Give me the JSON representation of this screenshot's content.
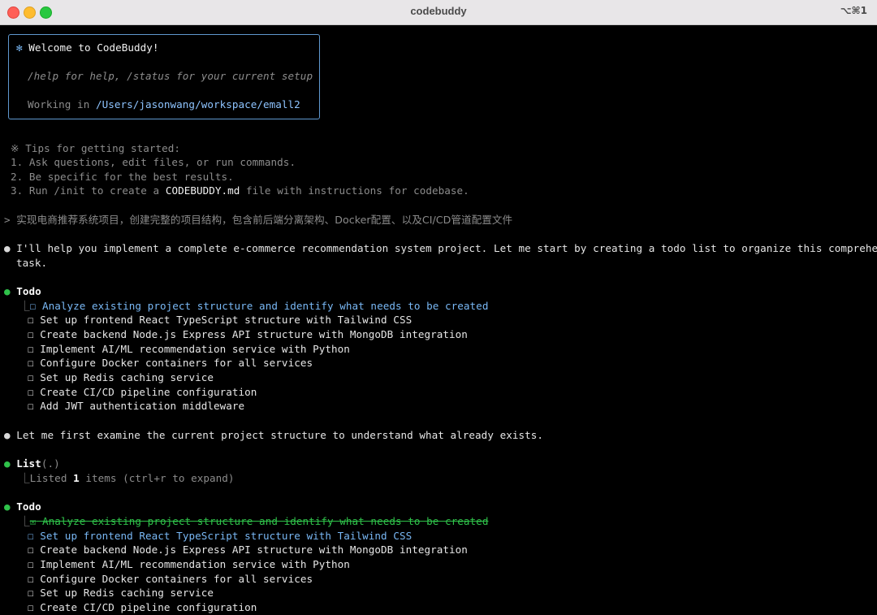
{
  "window": {
    "title": "codebuddy",
    "shortcut": "⌥⌘1"
  },
  "welcome": {
    "star": "✻",
    "title": "Welcome to CodeBuddy!",
    "help": "/help for help, /status for your current setup",
    "working_label": "Working in ",
    "working_path": "/Users/jasonwang/workspace/emall2"
  },
  "tips": {
    "heading": "※ Tips for getting started:",
    "items": [
      "1. Ask questions, edit files, or run commands.",
      "2. Be specific for the best results.",
      "3. Run /init to create a "
    ],
    "item3_file": "CODEBUDDY.md",
    "item3_suffix": " file with instructions for codebase."
  },
  "prompt": {
    "marker": ">",
    "text": "实现电商推荐系统项目，创建完整的项目结构，包含前后端分离架构、Docker配置、以及CI/CD管道配置文件"
  },
  "msg1": {
    "bullet": "●",
    "line1": "I'll help you implement a complete e-commerce recommendation system project. Let me start by creating a todo list to organize this comprehensive",
    "line2": "task."
  },
  "todo1": {
    "bullet": "●",
    "title": "Todo",
    "branch": "⎿",
    "box": "☐",
    "items": [
      "Analyze existing project structure and identify what needs to be created",
      "Set up frontend React TypeScript structure with Tailwind CSS",
      "Create backend Node.js Express API structure with MongoDB integration",
      "Implement AI/ML recommendation service with Python",
      "Configure Docker containers for all services",
      "Set up Redis caching service",
      "Create CI/CD pipeline configuration",
      "Add JWT authentication middleware"
    ]
  },
  "msg2": {
    "bullet": "●",
    "text": "Let me first examine the current project structure to understand what already exists."
  },
  "list": {
    "bullet": "●",
    "title": "List",
    "arg": "(.)",
    "branch": "⎿",
    "result_prefix": "Listed ",
    "count": "1",
    "result_suffix": " items (ctrl+r to expand)"
  },
  "todo2": {
    "bullet": "●",
    "title": "Todo",
    "branch": "⎿",
    "done_box": "☒",
    "box": "☐",
    "items": [
      "Analyze existing project structure and identify what needs to be created",
      "Set up frontend React TypeScript structure with Tailwind CSS",
      "Create backend Node.js Express API structure with MongoDB integration",
      "Implement AI/ML recommendation service with Python",
      "Configure Docker containers for all services",
      "Set up Redis caching service",
      "Create CI/CD pipeline configuration"
    ]
  }
}
